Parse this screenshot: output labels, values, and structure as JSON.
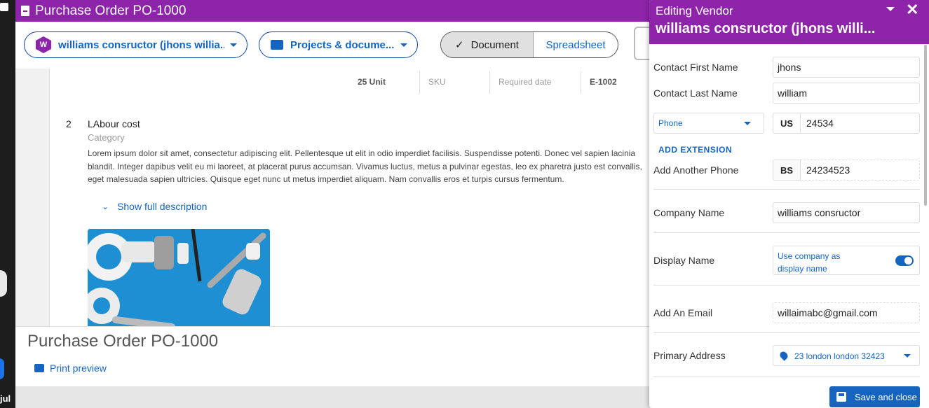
{
  "header": {
    "title": "Purchase Order PO-1000"
  },
  "toolbar": {
    "vendor_initial": "W",
    "vendor_label": "williams consructor (jhons willia...",
    "projects_label": "Projects & docume...",
    "view_document": "Document",
    "view_spreadsheet": "Spreadsheet"
  },
  "line_item_1": {
    "qty_unit": "25 Unit",
    "sku": "SKU",
    "required_date": "Required date",
    "code": "E-1002"
  },
  "line_item_2": {
    "number": "2",
    "name": "LAbour cost",
    "category": "Category",
    "description": "Lorem ipsum dolor sit amet, consectetur adipiscing elit. Pellentesque ut elit in odio imperdiet facilisis. Suspendisse potenti. Donec vel sapien lacinia blandit. Integer dapibus velit eu mi laoreet, at placerat purus accumsan. Vivamus luctus, metus a pulvinar egestas, leo ex pharetra justo est convallis, eget malesuada sapien ultricies. Quisque eget nunc ut metus imperdiet aliquam. Nam convallis eros et turpis cursus fermentum.",
    "show_full": "Show full description"
  },
  "footer": {
    "title": "Purchase Order  PO-1000",
    "print_preview": "Print preview"
  },
  "os": {
    "label": "jul"
  },
  "panel": {
    "heading": "Editing Vendor",
    "vendor_name": "williams consructor (jhons willi...",
    "contact_first_label": "Contact First Name",
    "contact_first_value": "jhons",
    "contact_last_label": "Contact Last Name",
    "contact_last_value": "william",
    "phone_type": "Phone",
    "phone_country": "US",
    "phone_value": "24534",
    "add_extension": "ADD EXTENSION",
    "another_phone_label": "Add Another Phone",
    "another_phone_country": "BS",
    "another_phone_value": "24234523",
    "company_label": "Company Name",
    "company_value": "williams consructor",
    "display_label": "Display Name",
    "use_company": "Use company as display name",
    "email_label": "Add An Email",
    "email_value": "willaimabc@gmail.com",
    "address_label": "Primary Address",
    "address_value": "23 london london 32423",
    "save_close": "Save and close"
  },
  "colors": {
    "brand": "#8e24aa",
    "link": "#1565c0"
  }
}
